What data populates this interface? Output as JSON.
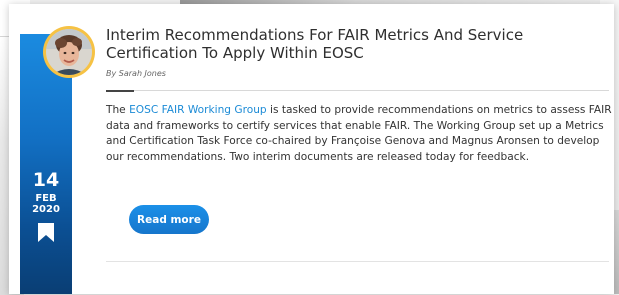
{
  "post": {
    "title": "Interim Recommendations For FAIR Metrics And Service Certification To Apply Within EOSC",
    "byline": "By Sarah Jones",
    "date": {
      "day": "14",
      "month": "FEB",
      "year": "2020"
    },
    "excerpt": {
      "prefix": "The ",
      "link_text": "EOSC FAIR Working Group",
      "rest": " is tasked to provide recommendations on metrics to assess FAIR data and frameworks to certify services that enable FAIR. The Working Group set up a Metrics and Certification Task Force co-chaired by Françoise Genova and Magnus Aronsen to develop our recommendations. Two interim documents are released today for feedback."
    },
    "read_more_label": "Read more"
  },
  "colors": {
    "accent": "#1c8bd6",
    "date_strip_top": "#1b8be0",
    "date_strip_bottom": "#0a3e74",
    "avatar_ring": "#f6c244"
  },
  "icons": {
    "bookmark": "bookmark-icon",
    "avatar": "author-avatar"
  }
}
